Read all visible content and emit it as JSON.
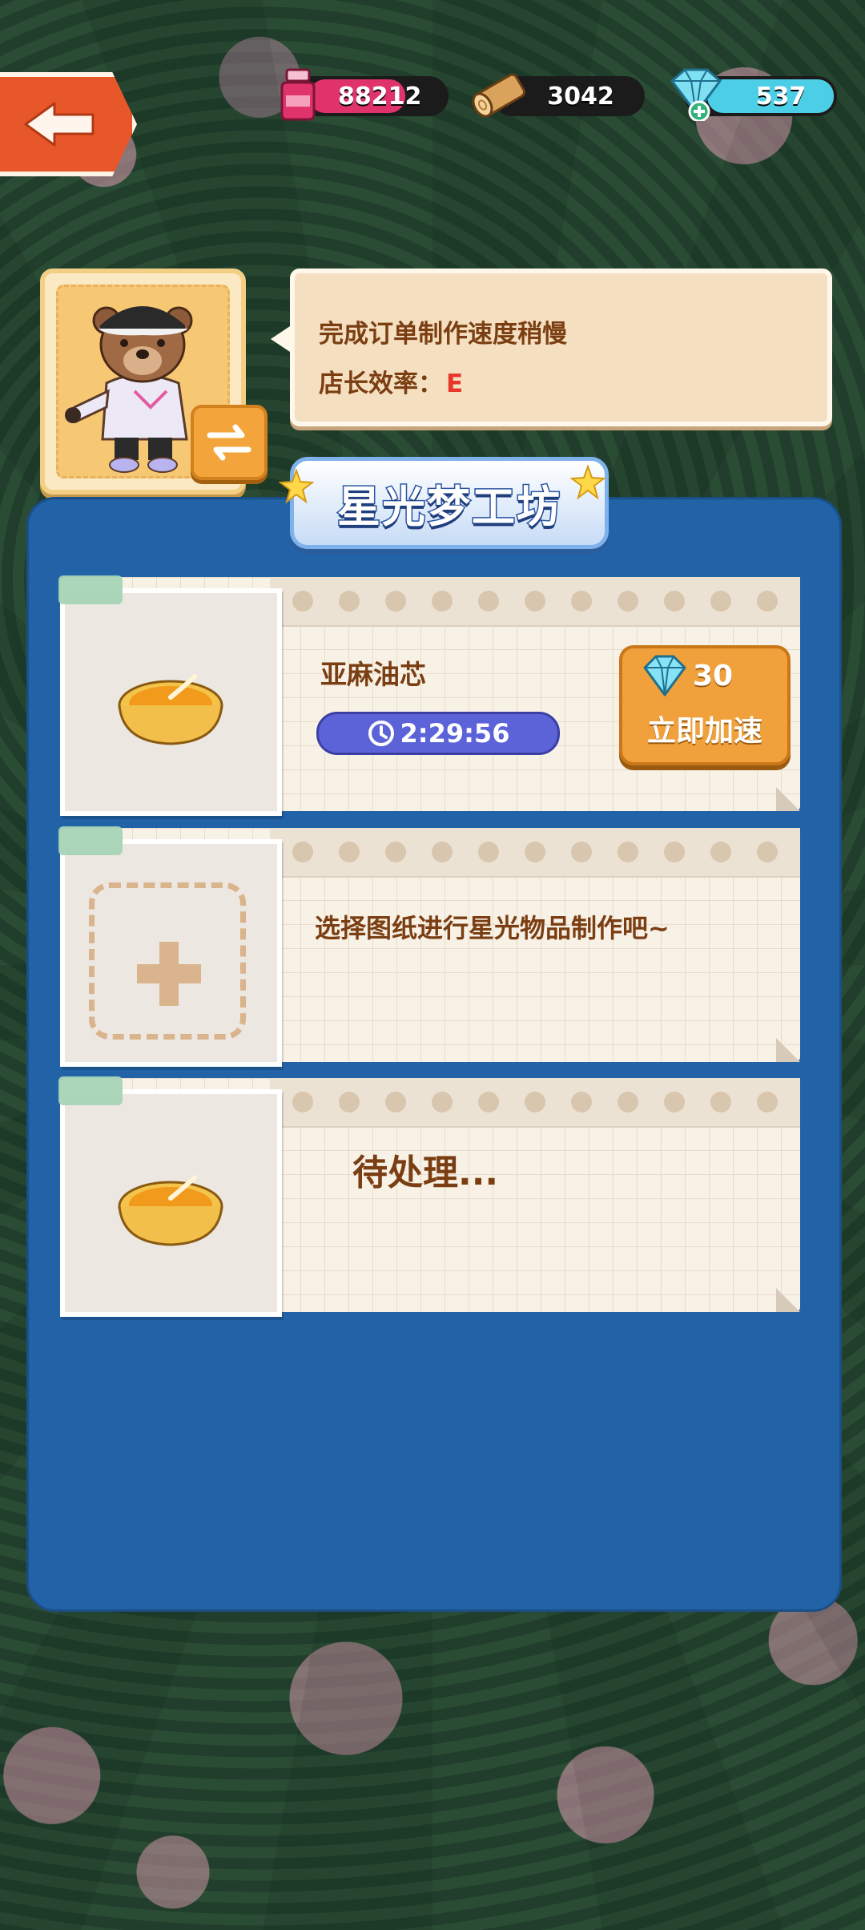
{
  "resources": {
    "ink": {
      "value": "88212",
      "icon": "ink-bottle-icon"
    },
    "wood": {
      "value": "3042",
      "icon": "wood-log-icon"
    },
    "gem": {
      "value": "537",
      "icon": "diamond-icon"
    }
  },
  "manager": {
    "line1": "完成订单制作速度稍慢",
    "line2_label": "店长效率：",
    "grade": "E",
    "grade_color": "#e8362a"
  },
  "workshop": {
    "title": "星光梦工坊",
    "slots": [
      {
        "state": "crafting",
        "item_name": "亚麻油芯",
        "timer": "2:29:56",
        "speedup_cost": "30",
        "speedup_label": "立即加速"
      },
      {
        "state": "empty",
        "hint": "选择图纸进行星光物品制作吧~"
      },
      {
        "state": "pending",
        "status": "待处理..."
      }
    ]
  },
  "colors": {
    "panel": "#2262a6",
    "accent_orange": "#f0a13b",
    "text_brown": "#7a3e12",
    "timer_purple": "#5c63d8"
  }
}
